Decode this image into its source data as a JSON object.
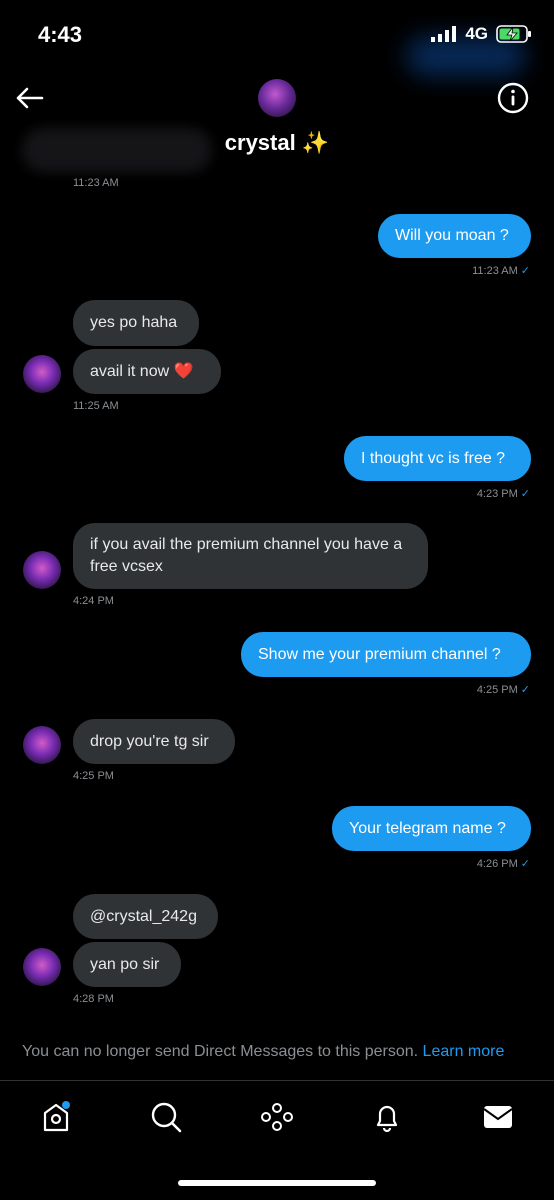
{
  "status_bar": {
    "time": "4:43",
    "network": "4G"
  },
  "header": {
    "name": "crystal ✨"
  },
  "messages": [
    {
      "side": "in",
      "text": "",
      "time": "11:23 AM"
    },
    {
      "side": "out",
      "text": "Will you moan ?",
      "time": "11:23 AM"
    },
    {
      "side": "in",
      "text": "yes po haha"
    },
    {
      "side": "in",
      "text": "avail it now ❤️",
      "time": "11:25 AM"
    },
    {
      "side": "out",
      "text": "I thought vc is free ?",
      "time": "4:23 PM"
    },
    {
      "side": "in",
      "text": "if you avail the premium channel you have a free vcsex",
      "time": "4:24 PM"
    },
    {
      "side": "out",
      "text": "Show me your premium channel ?",
      "time": "4:25 PM"
    },
    {
      "side": "in",
      "text": "drop you're tg sir",
      "time": "4:25 PM"
    },
    {
      "side": "out",
      "text": "Your telegram name ?",
      "time": "4:26 PM"
    },
    {
      "side": "in",
      "text": "@crystal_242g"
    },
    {
      "side": "in",
      "text": "yan po sir",
      "time": "4:28 PM"
    }
  ],
  "notice": {
    "text": "You can no longer send Direct Messages to this person.",
    "link": "Learn more"
  },
  "tabs": [
    "home-icon",
    "search-icon",
    "spaces-icon",
    "notifications-icon",
    "messages-icon"
  ],
  "colors": {
    "accent": "#1d9bf0",
    "incoming_bubble": "#2f3336",
    "background": "#000000"
  }
}
